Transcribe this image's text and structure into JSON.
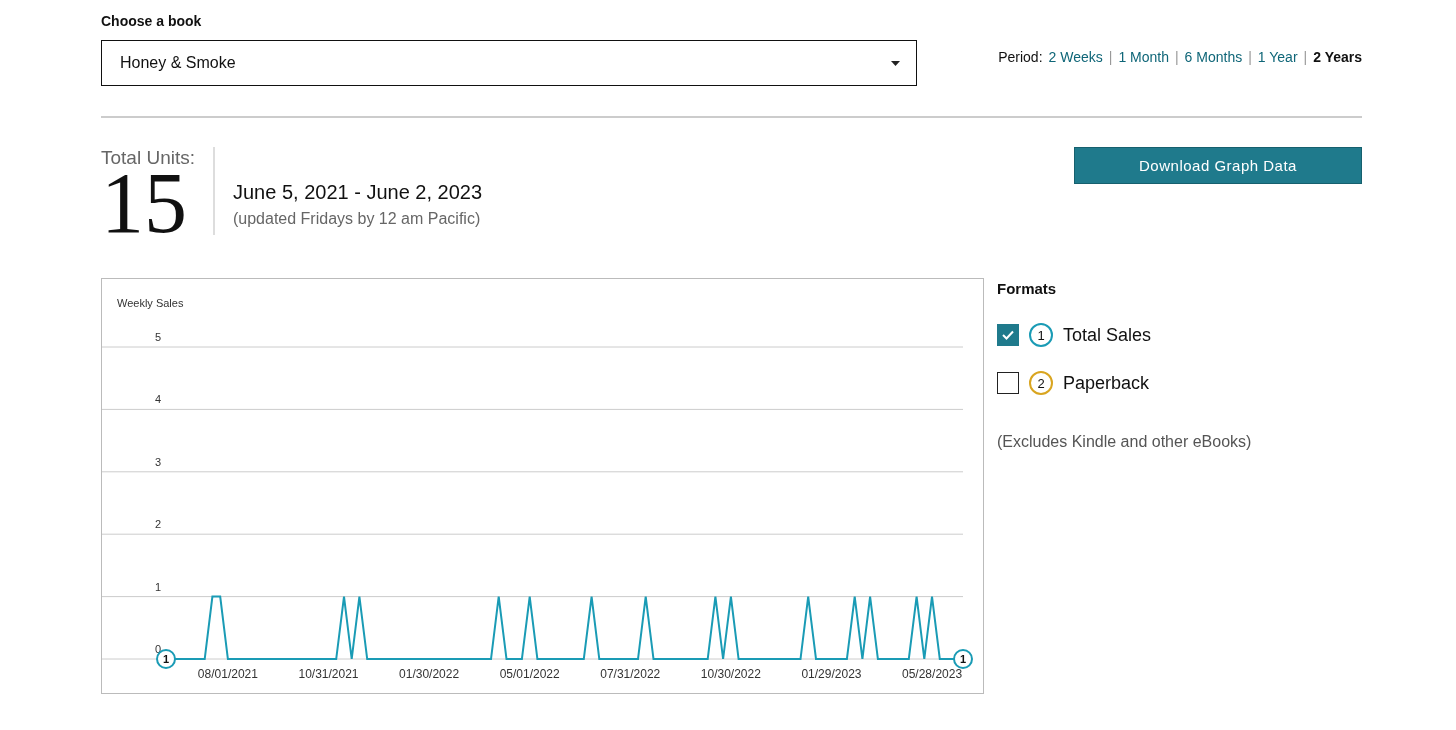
{
  "book_picker": {
    "label": "Choose a book",
    "value": "Honey & Smoke"
  },
  "period": {
    "label": "Period:",
    "separators": [
      "|",
      "|",
      "|",
      "|"
    ],
    "options": [
      {
        "label": "2 Weeks",
        "selected": false
      },
      {
        "label": "1 Month",
        "selected": false
      },
      {
        "label": "6 Months",
        "selected": false
      },
      {
        "label": "1 Year",
        "selected": false
      },
      {
        "label": "2 Years",
        "selected": true
      }
    ]
  },
  "summary": {
    "label": "Total Units:",
    "total": "15",
    "date_range": "June 5, 2021 - June 2, 2023",
    "note": "(updated Fridays by 12 am Pacific)"
  },
  "download_button": "Download Graph Data",
  "chart": {
    "end_markers": [
      "1",
      "1"
    ],
    "chart_data": {
      "type": "line",
      "grid": true,
      "ylabel": "Weekly Sales",
      "ylim": [
        0,
        5
      ],
      "yticks": [
        0,
        1,
        2,
        3,
        4,
        5
      ],
      "categories": [
        null,
        null,
        null,
        null,
        null,
        null,
        null,
        null,
        "08/01/2021",
        null,
        null,
        null,
        null,
        null,
        null,
        null,
        null,
        null,
        null,
        null,
        null,
        "10/31/2021",
        null,
        null,
        null,
        null,
        null,
        null,
        null,
        null,
        null,
        null,
        null,
        null,
        "01/30/2022",
        null,
        null,
        null,
        null,
        null,
        null,
        null,
        null,
        null,
        null,
        null,
        null,
        "05/01/2022",
        null,
        null,
        null,
        null,
        null,
        null,
        null,
        null,
        null,
        null,
        null,
        null,
        "07/31/2022",
        null,
        null,
        null,
        null,
        null,
        null,
        null,
        null,
        null,
        null,
        null,
        null,
        "10/30/2022",
        null,
        null,
        null,
        null,
        null,
        null,
        null,
        null,
        null,
        null,
        null,
        null,
        "01/29/2023",
        null,
        null,
        null,
        null,
        null,
        null,
        null,
        null,
        null,
        null,
        null,
        null,
        "05/28/2023",
        null,
        null,
        null,
        null
      ],
      "series": [
        {
          "color": "#1a9bb5",
          "values": [
            0,
            0,
            0,
            0,
            0,
            0,
            1,
            1,
            0,
            0,
            0,
            0,
            0,
            0,
            0,
            0,
            0,
            0,
            0,
            0,
            0,
            0,
            0,
            1,
            0,
            1,
            0,
            0,
            0,
            0,
            0,
            0,
            0,
            0,
            0,
            0,
            0,
            0,
            0,
            0,
            0,
            0,
            0,
            1,
            0,
            0,
            0,
            1,
            0,
            0,
            0,
            0,
            0,
            0,
            0,
            1,
            0,
            0,
            0,
            0,
            0,
            0,
            1,
            0,
            0,
            0,
            0,
            0,
            0,
            0,
            0,
            1,
            0,
            1,
            0,
            0,
            0,
            0,
            0,
            0,
            0,
            0,
            0,
            1,
            0,
            0,
            0,
            0,
            0,
            1,
            0,
            1,
            0,
            0,
            0,
            0,
            0,
            1,
            0,
            1,
            0,
            0,
            0,
            0
          ]
        }
      ]
    }
  },
  "formats": {
    "title": "Formats",
    "items": [
      {
        "number": "1",
        "label": "Total Sales",
        "checked": true,
        "color": "#1a9bb5"
      },
      {
        "number": "2",
        "label": "Paperback",
        "checked": false,
        "color": "#d9a520"
      }
    ],
    "note": "(Excludes Kindle and other eBooks)"
  }
}
